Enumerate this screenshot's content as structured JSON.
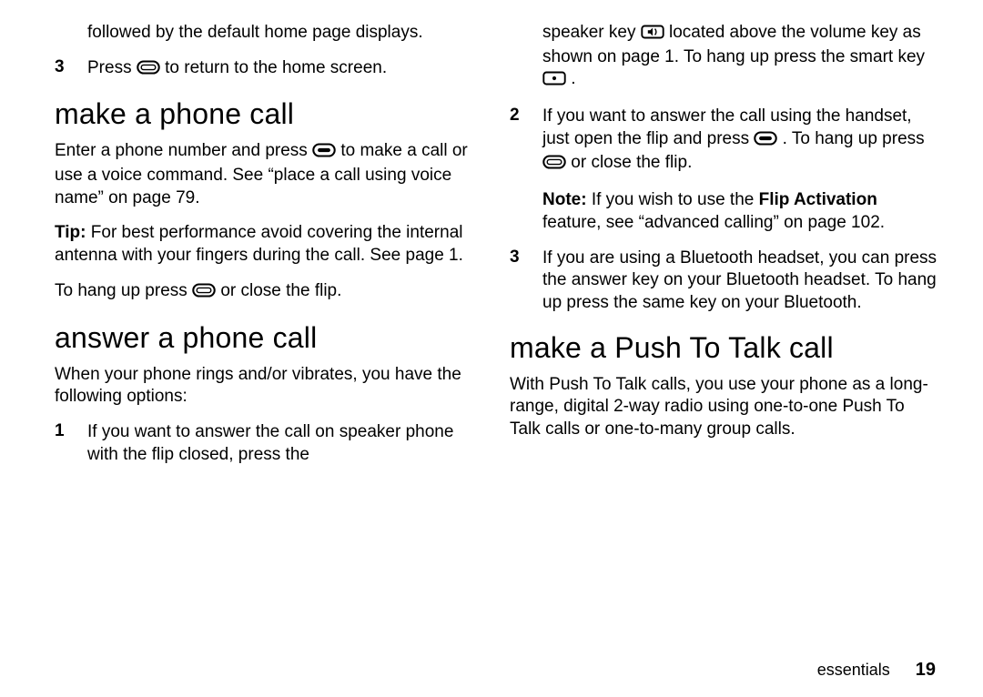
{
  "left": {
    "continuation1": "followed by the default home page displays.",
    "item3_before": "Press ",
    "item3_after": " to return to the home screen.",
    "heading_make": "make a phone call",
    "make_p1_before": "Enter a phone number and press ",
    "make_p1_after": " to make a call or use a voice command. See “place a call using voice name” on page 79.",
    "tip_label": "Tip:",
    "tip_text": " For best performance avoid covering the internal antenna with your fingers during the call. See page 1.",
    "hangup_before": "To hang up press ",
    "hangup_after": " or close the flip.",
    "heading_answer": "answer a phone call",
    "answer_intro": "When your phone rings and/or vibrates, you have the following options:",
    "answer_item1": "If you want to answer the call on speaker phone with the flip closed, press the"
  },
  "right": {
    "cont_before": "speaker key ",
    "cont_mid": " located above the volume key as shown on page 1. To hang up press the smart key ",
    "cont_after": ".",
    "item2_a_before": "If you want to answer the call using the handset, just open the flip and press ",
    "item2_a_after": ". To hang up press ",
    "item2_a_tail": " or close the flip.",
    "note_label": "Note:",
    "note_before": " If you wish to use the ",
    "flip_activation": "Flip Activation",
    "note_after": " feature, see “advanced calling” on page 102.",
    "item3": "If you are using a Bluetooth headset, you can press the answer key on your Bluetooth headset. To hang up press the same key on your Bluetooth.",
    "heading_ptt": "make a Push To Talk call",
    "ptt_intro": "With Push To Talk calls, you use your phone as a long-range, digital 2-way radio using one-to-one Push To Talk calls or one-to-many group calls."
  },
  "nums": {
    "n1": "1",
    "n2": "2",
    "n3": "3"
  },
  "icons": {
    "pill_empty": "pill-key-icon",
    "pill_dash": "pill-dash-key-icon",
    "speaker": "speaker-key-icon",
    "dot": "dot-key-icon"
  },
  "footer": {
    "section": "essentials",
    "page": "19"
  }
}
